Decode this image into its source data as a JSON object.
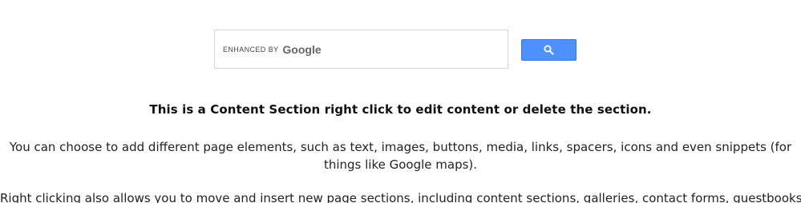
{
  "search": {
    "enhanced_by": "ENHANCED BY",
    "brand": "Google",
    "button_icon": "search-icon"
  },
  "content": {
    "heading": "This is a Content Section right click to edit content or delete the section.",
    "paragraph1": "You can choose to add different page elements, such as text, images, buttons, media, links, spacers, icons and even snippets (for things like Google maps).",
    "paragraph2": "Right clicking also allows you to move and insert new page sections, including content sections, galleries, contact forms, guestbooks"
  },
  "colors": {
    "search_button": "#4d90fe",
    "search_border": "#d7d7d7"
  }
}
